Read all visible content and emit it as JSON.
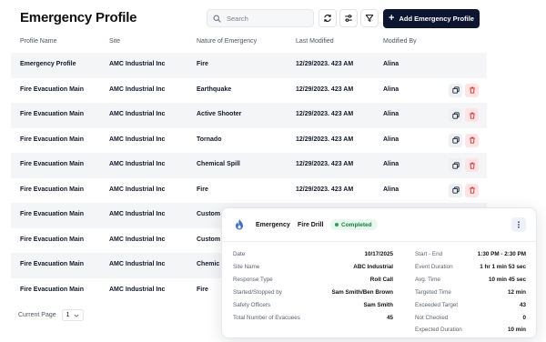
{
  "header": {
    "title": "Emergency Profile",
    "search_placeholder": "Search",
    "add_label": "Add Emergency Profile"
  },
  "table": {
    "columns": [
      "Profile Name",
      "Site",
      "Nature of Emergency",
      "Last Modified",
      "Modified By"
    ],
    "rows": [
      [
        "Emergency Profile",
        "AMC Industrial Inc",
        "Fire",
        "12/29/2023. 423 AM",
        "Alina"
      ],
      [
        "Fire Evacuation Main",
        "AMC Industrial Inc",
        "Earthquake",
        "12/29/2023. 423 AM",
        "Alina"
      ],
      [
        "Fire Evacuation Main",
        "AMC Industrial Inc",
        "Active Shooter",
        "12/29/2023. 423 AM",
        "Alina"
      ],
      [
        "Fire Evacuation Main",
        "AMC Industrial Inc",
        "Tornado",
        "12/29/2023. 423 AM",
        "Alina"
      ],
      [
        "Fire Evacuation Main",
        "AMC Industrial Inc",
        "Chemical Spill",
        "12/29/2023. 423 AM",
        "Alina"
      ],
      [
        "Fire Evacuation Main",
        "AMC Industrial Inc",
        "Fire",
        "12/29/2023. 423 AM",
        "Alina"
      ],
      [
        "Fire Evacuation Main",
        "AMC Industrial Inc",
        "Custom",
        "",
        ""
      ],
      [
        "Fire Evacuation Main",
        "AMC Industrial Inc",
        "Custom",
        "",
        ""
      ],
      [
        "Fire Evacuation Main",
        "AMC Industrial Inc",
        "Chemic",
        "",
        ""
      ],
      [
        "Fire Evacuation Main",
        "AMC Industrial Inc",
        "Fire",
        "",
        ""
      ]
    ]
  },
  "pagination": {
    "label": "Current Page",
    "value": "1"
  },
  "drill_card": {
    "type_label": "Emergency",
    "name": "Fire Drill",
    "status": "Completed",
    "left": [
      {
        "label": "Date",
        "value": "10/17/2025"
      },
      {
        "label": "Site Name",
        "value": "ABC Industrial"
      },
      {
        "label": "Response Type",
        "value": "Roll Call"
      },
      {
        "label": "Started/Stopped by",
        "value": "Sam Smith/Ben Brown"
      },
      {
        "label": "Safety Officers",
        "value": "Sam Smith"
      },
      {
        "label": "Total Number of Evacuees",
        "value": "45"
      }
    ],
    "right": [
      {
        "label": "Start - End",
        "value": "1:30 PM - 2:30 PM"
      },
      {
        "label": "Event Duration",
        "value": "1 hr 1 min 53 sec"
      },
      {
        "label": "Avg. Time",
        "value": "10 min 45 sec"
      },
      {
        "label": "Targeted Time",
        "value": "12 min"
      },
      {
        "label": "Exceeded Target",
        "value": "43"
      },
      {
        "label": "Not Checked",
        "value": "0"
      },
      {
        "label": "Expected Duration",
        "value": "10 min"
      }
    ]
  },
  "colors": {
    "primary_button": "#0d1630",
    "delete_red": "#e03131",
    "status_green": "#16803c",
    "flame_blue": "#3b6fd8"
  }
}
